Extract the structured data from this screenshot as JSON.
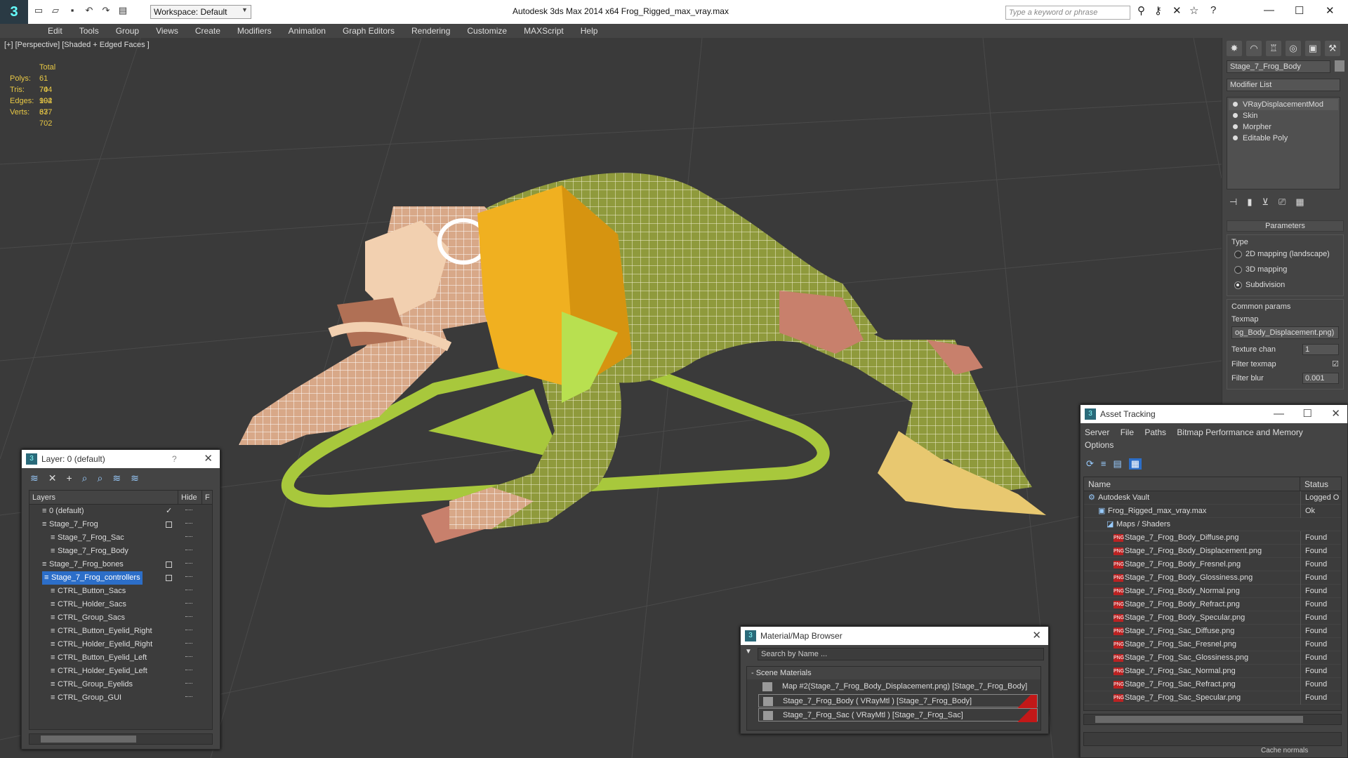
{
  "app": {
    "title": "Autodesk 3ds Max  2014 x64      Frog_Rigged_max_vray.max",
    "workspace": "Workspace: Default",
    "search_placeholder": "Type a keyword or phrase"
  },
  "menu": [
    "Edit",
    "Tools",
    "Group",
    "Views",
    "Create",
    "Modifiers",
    "Animation",
    "Graph Editors",
    "Rendering",
    "Customize",
    "MAXScript",
    "Help"
  ],
  "viewport": {
    "label": "[+] [Perspective] [Shaded + Edged Faces ]",
    "stats": {
      "header": "Total",
      "rows": [
        {
          "k": "Polys:",
          "v": "61 704"
        },
        {
          "k": "Tris:",
          "v": "74 994"
        },
        {
          "k": "Edges:",
          "v": "102 637"
        },
        {
          "k": "Verts:",
          "v": "37 702"
        }
      ]
    }
  },
  "command_panel": {
    "object_name": "Stage_7_Frog_Body",
    "modifier_list": "Modifier List",
    "stack": [
      "VRayDisplacementMod",
      "Skin",
      "Morpher",
      "Editable Poly"
    ],
    "parameters_label": "Parameters",
    "type_label": "Type",
    "type_options": [
      "2D mapping (landscape)",
      "3D mapping",
      "Subdivision"
    ],
    "common_params": "Common params",
    "texmap_label": "Texmap",
    "texmap_value": "og_Body_Displacement.png)",
    "texture_chan_label": "Texture chan",
    "texture_chan_value": "1",
    "filter_texmap_label": "Filter texmap",
    "filter_blur_label": "Filter blur",
    "filter_blur_value": "0.001"
  },
  "layer_window": {
    "title": "Layer: 0 (default)",
    "help": "?",
    "col_layers": "Layers",
    "col_hide": "Hide",
    "col_f": "F",
    "rows": [
      {
        "name": "0 (default)",
        "indent": 1,
        "mark": "check"
      },
      {
        "name": "Stage_7_Frog",
        "indent": 1,
        "mark": "box"
      },
      {
        "name": "Stage_7_Frog_Sac",
        "indent": 2,
        "mark": ""
      },
      {
        "name": "Stage_7_Frog_Body",
        "indent": 2,
        "mark": ""
      },
      {
        "name": "Stage_7_Frog_bones",
        "indent": 1,
        "mark": "box"
      },
      {
        "name": "Stage_7_Frog_controllers",
        "indent": 1,
        "mark": "box",
        "selected": true
      },
      {
        "name": "CTRL_Button_Sacs",
        "indent": 2,
        "mark": ""
      },
      {
        "name": "CTRL_Holder_Sacs",
        "indent": 2,
        "mark": ""
      },
      {
        "name": "CTRL_Group_Sacs",
        "indent": 2,
        "mark": ""
      },
      {
        "name": "CTRL_Button_Eyelid_Right",
        "indent": 2,
        "mark": ""
      },
      {
        "name": "CTRL_Holder_Eyelid_Right",
        "indent": 2,
        "mark": ""
      },
      {
        "name": "CTRL_Button_Eyelid_Left",
        "indent": 2,
        "mark": ""
      },
      {
        "name": "CTRL_Holder_Eyelid_Left",
        "indent": 2,
        "mark": ""
      },
      {
        "name": "CTRL_Group_Eyelids",
        "indent": 2,
        "mark": ""
      },
      {
        "name": "CTRL_Group_GUI",
        "indent": 2,
        "mark": ""
      }
    ]
  },
  "asset_window": {
    "title": "Asset Tracking",
    "menu": [
      "Server",
      "File",
      "Paths",
      "Bitmap Performance and Memory",
      "Options"
    ],
    "col_name": "Name",
    "col_status": "Status",
    "rows": [
      {
        "name": "Autodesk Vault",
        "status": "Logged O",
        "indent": 1,
        "icon": "vault"
      },
      {
        "name": "Frog_Rigged_max_vray.max",
        "status": "Ok",
        "indent": 2,
        "icon": "max"
      },
      {
        "name": "Maps / Shaders",
        "status": "",
        "indent": 3,
        "icon": "maps"
      },
      {
        "name": "Stage_7_Frog_Body_Diffuse.png",
        "status": "Found",
        "indent": 4,
        "icon": "png"
      },
      {
        "name": "Stage_7_Frog_Body_Displacement.png",
        "status": "Found",
        "indent": 4,
        "icon": "png"
      },
      {
        "name": "Stage_7_Frog_Body_Fresnel.png",
        "status": "Found",
        "indent": 4,
        "icon": "png"
      },
      {
        "name": "Stage_7_Frog_Body_Glossiness.png",
        "status": "Found",
        "indent": 4,
        "icon": "png"
      },
      {
        "name": "Stage_7_Frog_Body_Normal.png",
        "status": "Found",
        "indent": 4,
        "icon": "png"
      },
      {
        "name": "Stage_7_Frog_Body_Refract.png",
        "status": "Found",
        "indent": 4,
        "icon": "png"
      },
      {
        "name": "Stage_7_Frog_Body_Specular.png",
        "status": "Found",
        "indent": 4,
        "icon": "png"
      },
      {
        "name": "Stage_7_Frog_Sac_Diffuse.png",
        "status": "Found",
        "indent": 4,
        "icon": "png"
      },
      {
        "name": "Stage_7_Frog_Sac_Fresnel.png",
        "status": "Found",
        "indent": 4,
        "icon": "png"
      },
      {
        "name": "Stage_7_Frog_Sac_Glossiness.png",
        "status": "Found",
        "indent": 4,
        "icon": "png"
      },
      {
        "name": "Stage_7_Frog_Sac_Normal.png",
        "status": "Found",
        "indent": 4,
        "icon": "png"
      },
      {
        "name": "Stage_7_Frog_Sac_Refract.png",
        "status": "Found",
        "indent": 4,
        "icon": "png"
      },
      {
        "name": "Stage_7_Frog_Sac_Specular.png",
        "status": "Found",
        "indent": 4,
        "icon": "png"
      }
    ],
    "footer": "Cache normals"
  },
  "material_window": {
    "title": "Material/Map Browser",
    "search_placeholder": "Search by Name ...",
    "section": "- Scene Materials",
    "rows": [
      {
        "name": "Map #2(Stage_7_Frog_Body_Displacement.png) [Stage_7_Frog_Body]",
        "red": false
      },
      {
        "name": "Stage_7_Frog_Body  ( VRayMtl ) [Stage_7_Frog_Body]",
        "red": true
      },
      {
        "name": "Stage_7_Frog_Sac  ( VRayMtl ) [Stage_7_Frog_Sac]",
        "red": true
      }
    ]
  },
  "colors": {
    "accent": "#2c6ec8",
    "stats": "#e8c845",
    "frog_body": "#8f9a3c",
    "frog_skin": "#d8a888",
    "frog_yellow": "#f0b020",
    "controller_green": "#a8c83c",
    "bone": "#c8806c"
  }
}
